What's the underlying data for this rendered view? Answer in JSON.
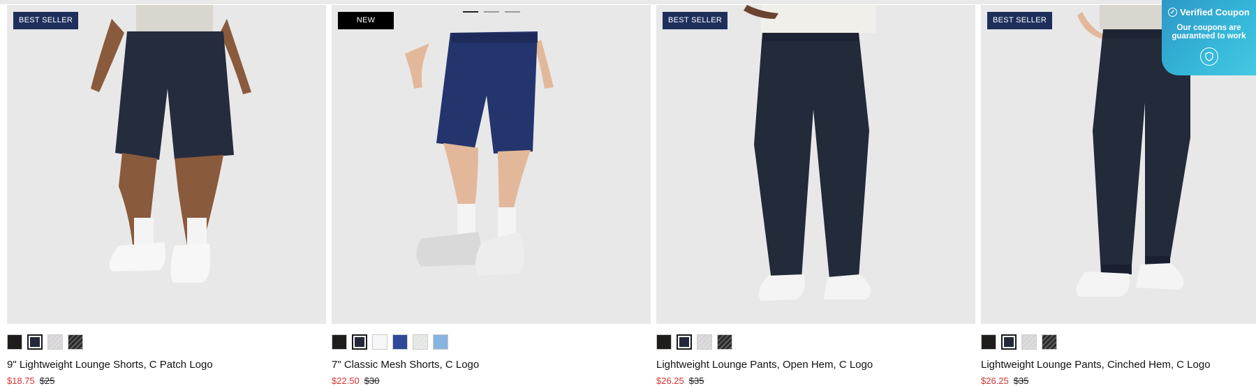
{
  "products": [
    {
      "badge": "BEST SELLER",
      "badge_style": "best",
      "name": "9\" Lightweight Lounge Shorts, C Patch Logo",
      "sale_price": "$18.75",
      "original_price": "$25",
      "garment": "shorts",
      "skin": "#8a5a3c",
      "swatches": [
        {
          "color": "#1f1c1c",
          "pattern": false
        },
        {
          "color": "#23283a",
          "pattern": false,
          "selected": true
        },
        {
          "color": "#d6d4d6",
          "pattern": true
        },
        {
          "color": "#2a2a2a",
          "pattern": true
        }
      ]
    },
    {
      "badge": "NEW",
      "badge_style": "new",
      "name": "7\" Classic Mesh Shorts, C Logo",
      "sale_price": "$22.50",
      "original_price": "$30",
      "garment": "mesh-shorts",
      "skin": "#e3b89a",
      "swatches": [
        {
          "color": "#1f1c1c",
          "pattern": false
        },
        {
          "color": "#23283a",
          "pattern": false,
          "selected": true
        },
        {
          "color": "#f7f7f9",
          "pattern": false
        },
        {
          "color": "#2e4b9a",
          "pattern": false
        },
        {
          "color": "#e3e6e3",
          "pattern": true
        },
        {
          "color": "#86b4de",
          "pattern": false
        }
      ]
    },
    {
      "badge": "BEST SELLER",
      "badge_style": "best",
      "name": "Lightweight Lounge Pants, Open Hem, C Logo",
      "sale_price": "$26.25",
      "original_price": "$35",
      "garment": "pants",
      "skin": "#6b4430",
      "swatches": [
        {
          "color": "#1f1c1c",
          "pattern": false
        },
        {
          "color": "#23283a",
          "pattern": false,
          "selected": true
        },
        {
          "color": "#d6d4d6",
          "pattern": true
        },
        {
          "color": "#2a2a2a",
          "pattern": true
        }
      ]
    },
    {
      "badge": "BEST SELLER",
      "badge_style": "best",
      "name": "Lightweight Lounge Pants, Cinched Hem, C Logo",
      "sale_price": "$26.25",
      "original_price": "$35",
      "garment": "joggers",
      "skin": "#e3b89a",
      "swatches": [
        {
          "color": "#1f1c1c",
          "pattern": false
        },
        {
          "color": "#23283a",
          "pattern": false,
          "selected": true
        },
        {
          "color": "#d6d4d6",
          "pattern": true
        },
        {
          "color": "#2a2a2a",
          "pattern": true
        }
      ]
    }
  ],
  "coupon": {
    "title": "Verified Coupon",
    "subtitle": "Our coupons are guaranteed to work",
    "icon": "shield-check-icon"
  },
  "colors": {
    "sale": "#d7332f",
    "badge_best": "#1f2f5c",
    "photo_bg": "#e8e8e9"
  }
}
